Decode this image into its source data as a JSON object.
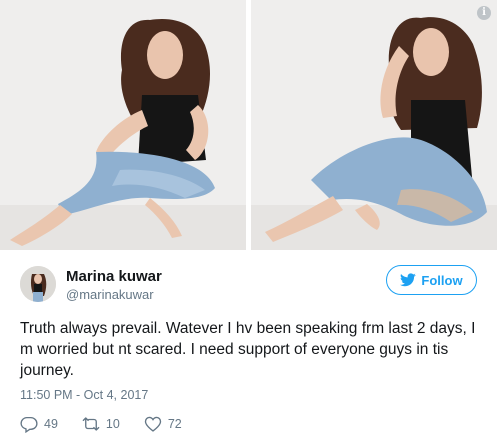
{
  "tweet": {
    "display_name": "Marina kuwar",
    "handle": "@marinakuwar",
    "follow_label": "Follow",
    "text": "Truth always prevail. Watever I hv been speaking frm last 2 days, I m worried but nt scared. I need support of everyone guys in tis journey.",
    "timestamp": "11:50 PM - Oct 4, 2017",
    "replies": "49",
    "retweets": "10",
    "likes": "72"
  },
  "icons": {
    "info": "info-icon",
    "bird": "twitter-bird-icon",
    "reply": "reply-icon",
    "retweet": "retweet-icon",
    "like": "heart-icon"
  },
  "colors": {
    "accent": "#1da1f2",
    "secondary_text": "#657786",
    "primary_text": "#14171a",
    "photo_background": "#ecebea",
    "denim": "#8fb0d0"
  }
}
